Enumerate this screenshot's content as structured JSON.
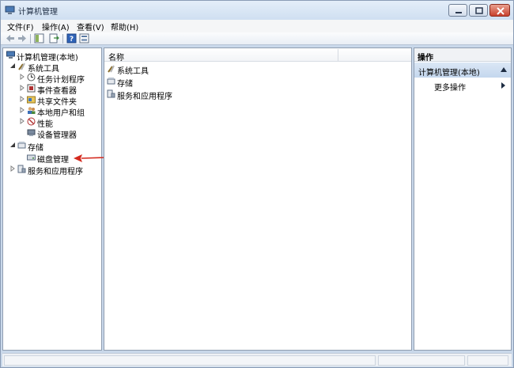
{
  "window": {
    "title": "计算机管理"
  },
  "menu": [
    "文件(F)",
    "操作(A)",
    "查看(V)",
    "帮助(H)"
  ],
  "tree": {
    "root": "计算机管理(本地)",
    "system_tools": "系统工具",
    "task_scheduler": "任务计划程序",
    "event_viewer": "事件查看器",
    "shared_folders": "共享文件夹",
    "local_users": "本地用户和组",
    "performance": "性能",
    "device_manager": "设备管理器",
    "storage": "存储",
    "disk_management": "磁盘管理",
    "services_apps": "服务和应用程序"
  },
  "list": {
    "column_name": "名称",
    "rows": [
      "系统工具",
      "存储",
      "服务和应用程序"
    ]
  },
  "actions": {
    "header": "操作",
    "group": "计算机管理(本地)",
    "more": "更多操作"
  },
  "colors": {
    "annotation_arrow": "#d42a1f",
    "selection": "#c4d7ee"
  }
}
